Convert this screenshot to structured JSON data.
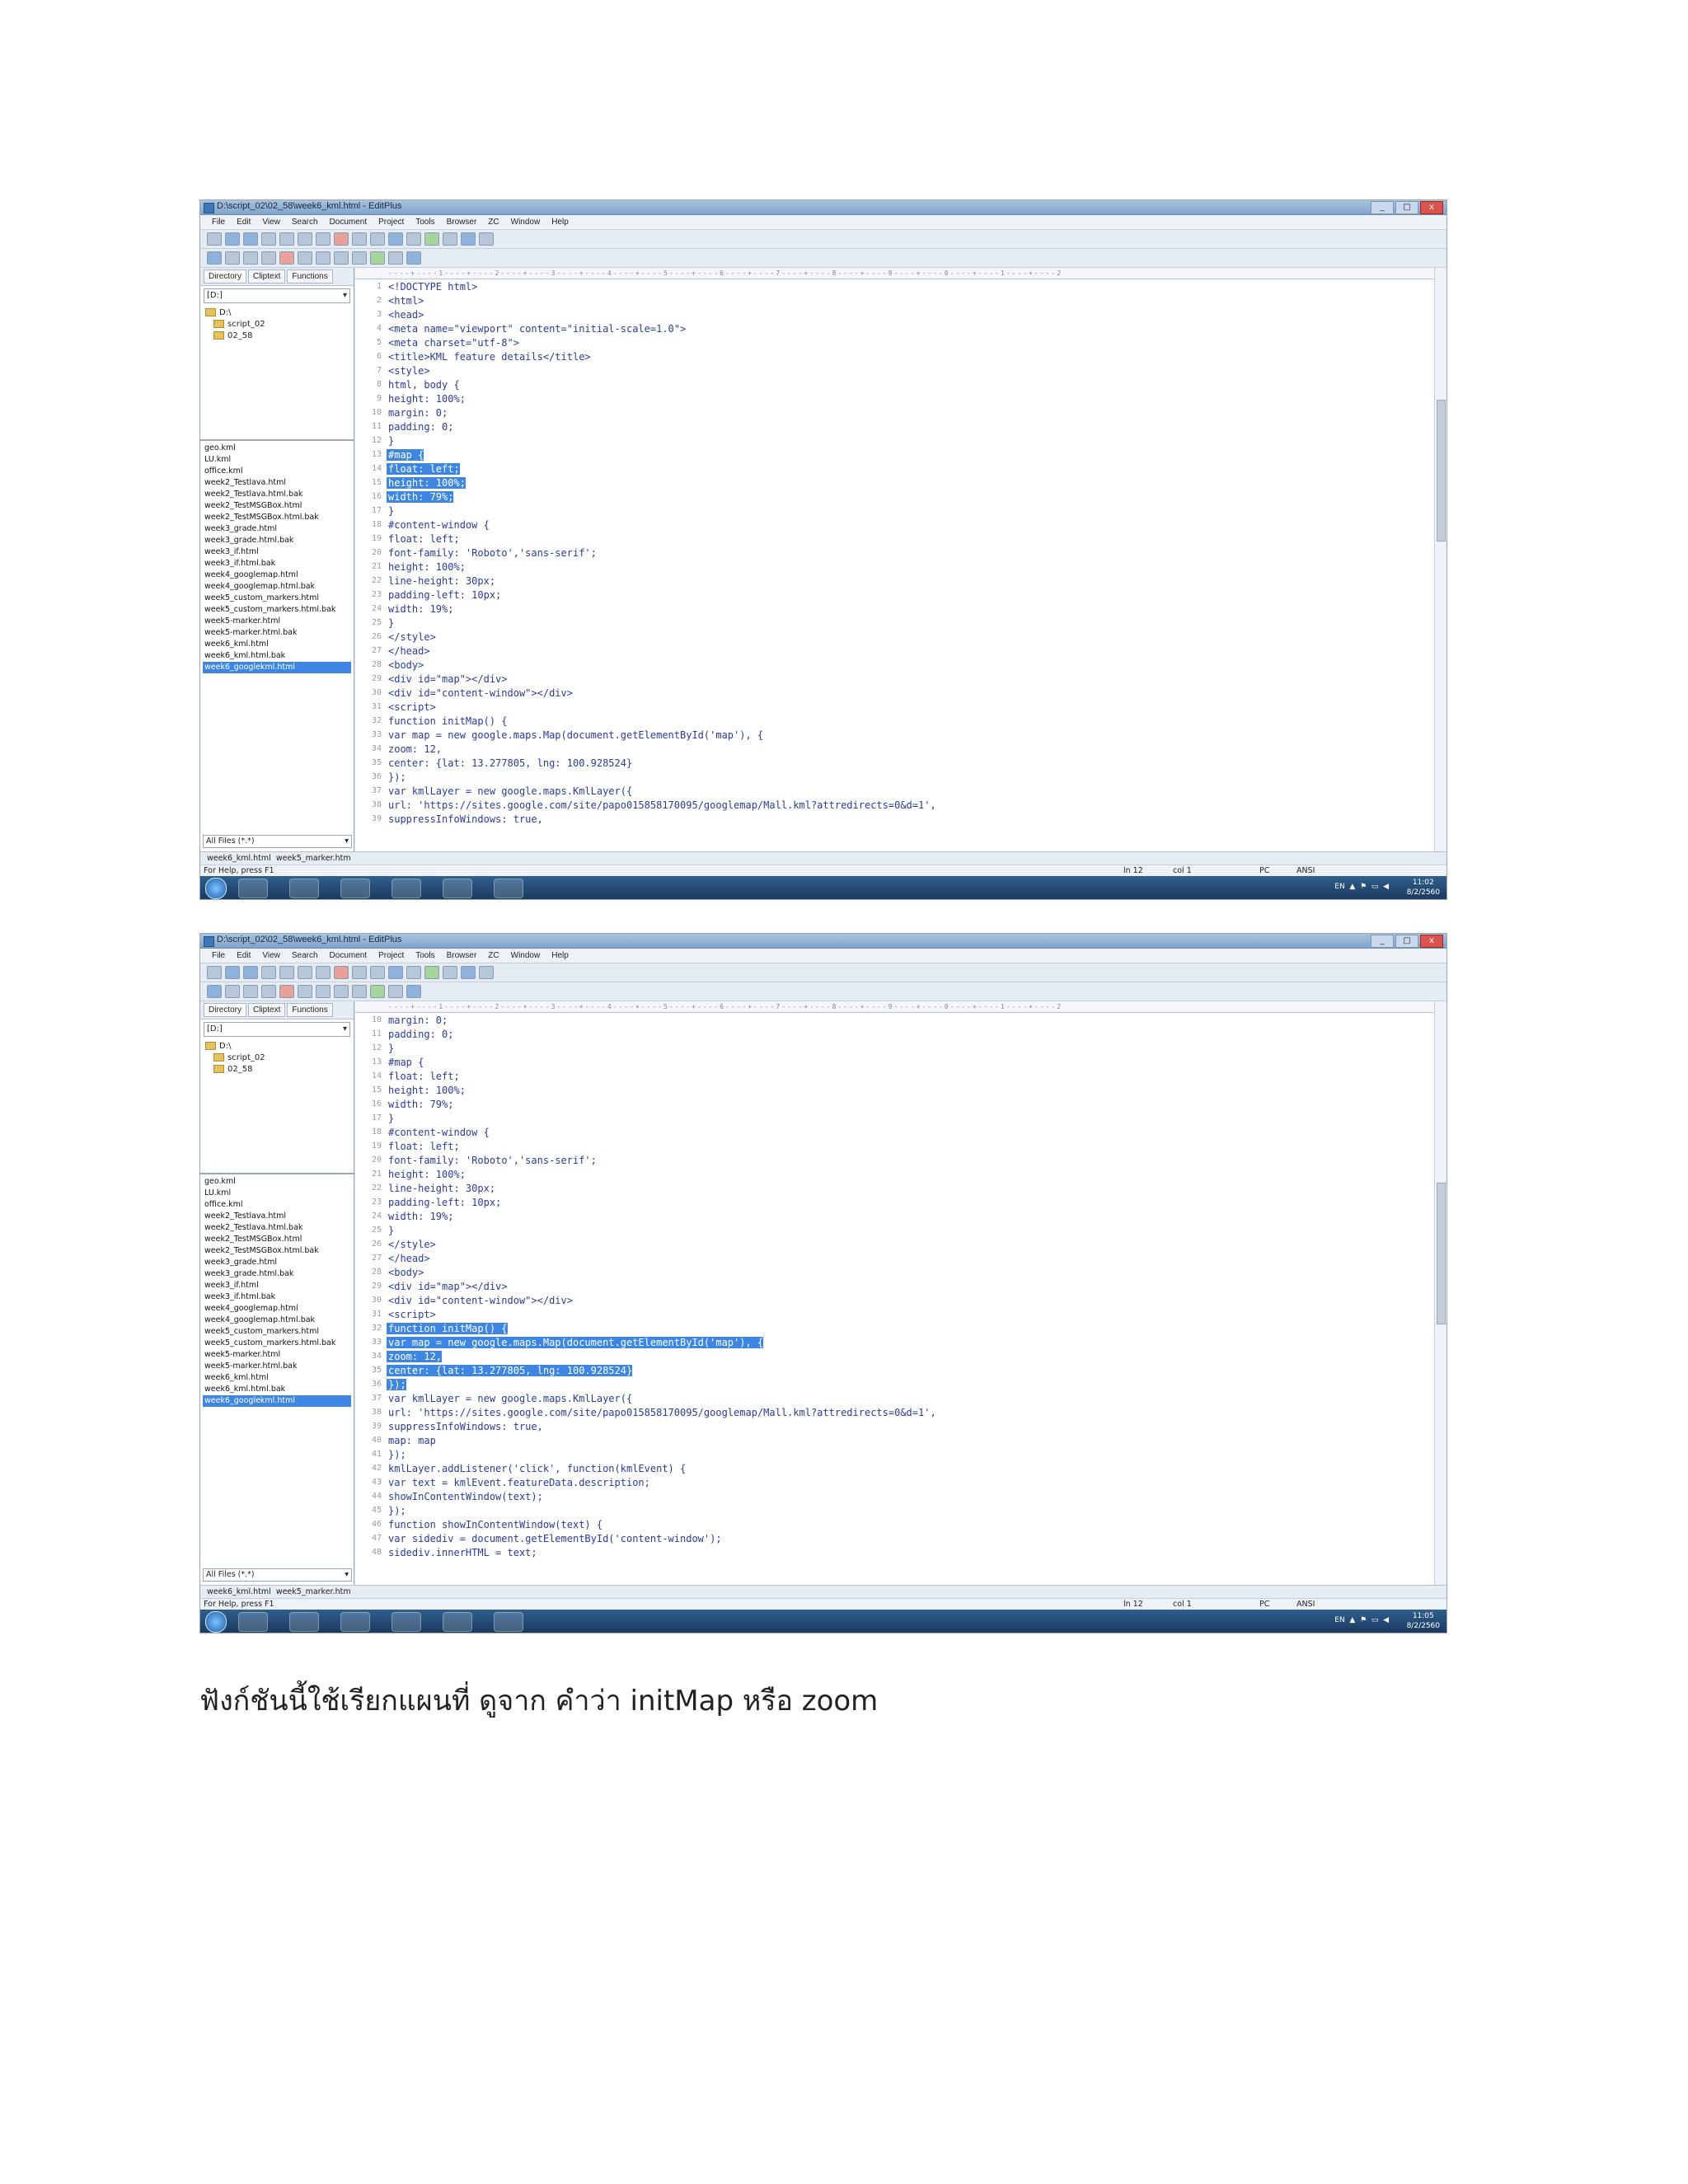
{
  "window": {
    "title": "D:\\script_02\\02_58\\week6_kml.html - EditPlus",
    "buttons": [
      "_",
      "□",
      "x"
    ]
  },
  "menu": [
    "File",
    "Edit",
    "View",
    "Search",
    "Document",
    "Project",
    "Tools",
    "Browser",
    "ZC",
    "Window",
    "Help"
  ],
  "left_pane": {
    "tabs": [
      "Directory",
      "Cliptext",
      "Functions"
    ],
    "drive": "[D:]",
    "tree": [
      "D:\\",
      "script_02",
      "02_58"
    ],
    "files": [
      "geo.kml",
      "LU.kml",
      "office.kml",
      "week2_Testlava.html",
      "week2_Testlava.html.bak",
      "week2_TestMSGBox.html",
      "week2_TestMSGBox.html.bak",
      "week3_grade.html",
      "week3_grade.html.bak",
      "week3_if.html",
      "week3_if.html.bak",
      "week4_googlemap.html",
      "week4_googlemap.html.bak",
      "week5_custom_markers.html",
      "week5_custom_markers.html.bak",
      "week5-marker.html",
      "week5-marker.html.bak",
      "week6_kml.html",
      "week6_kml.html.bak",
      "week6_googlekml.html"
    ],
    "filter": "All Files (*.*)"
  },
  "doc_tabs": [
    "week6_kml.html",
    "week5_marker.htm"
  ],
  "status": {
    "help": "For Help, press F1",
    "ln": "ln 12",
    "col": "col 1",
    "enc": "ANSI",
    "mode": "PC"
  },
  "taskbar": {
    "tray": "EN  ▲  ⚑  ▭  ◀",
    "time1": "11:02",
    "time2": "11:05",
    "date": "8/2/2560"
  },
  "editor1": {
    "lines": [
      {
        "n": "1",
        "t": "<!DOCTYPE html>",
        "hl": false
      },
      {
        "n": "2",
        "t": "<html>",
        "hl": false
      },
      {
        "n": "3",
        "t": "<head>",
        "hl": false
      },
      {
        "n": "4",
        "t": "<meta name=\"viewport\" content=\"initial-scale=1.0\">",
        "hl": false
      },
      {
        "n": "5",
        "t": "<meta charset=\"utf-8\">",
        "hl": false
      },
      {
        "n": "6",
        "t": "<title>KML feature details</title>",
        "hl": false
      },
      {
        "n": "7",
        "t": "<style>",
        "hl": false
      },
      {
        "n": "8",
        "t": "html, body {",
        "hl": false
      },
      {
        "n": "9",
        "t": "height: 100%;",
        "hl": false
      },
      {
        "n": "10",
        "t": "margin: 0;",
        "hl": false
      },
      {
        "n": "11",
        "t": "padding: 0;",
        "hl": false
      },
      {
        "n": "12",
        "t": "}",
        "hl": false
      },
      {
        "n": "13",
        "t": "#map {",
        "hl": true
      },
      {
        "n": "14",
        "t": "float: left;",
        "hl": true
      },
      {
        "n": "15",
        "t": "height: 100%;",
        "hl": true
      },
      {
        "n": "16",
        "t": "width: 79%;",
        "hl": true
      },
      {
        "n": "17",
        "t": "}",
        "hl": false
      },
      {
        "n": "18",
        "t": "#content-window {",
        "hl": false
      },
      {
        "n": "19",
        "t": "float: left;",
        "hl": false
      },
      {
        "n": "20",
        "t": "font-family: 'Roboto','sans-serif';",
        "hl": false
      },
      {
        "n": "21",
        "t": "height: 100%;",
        "hl": false
      },
      {
        "n": "22",
        "t": "line-height: 30px;",
        "hl": false
      },
      {
        "n": "23",
        "t": "padding-left: 10px;",
        "hl": false
      },
      {
        "n": "24",
        "t": "width: 19%;",
        "hl": false
      },
      {
        "n": "25",
        "t": "}",
        "hl": false
      },
      {
        "n": "26",
        "t": "</style>",
        "hl": false
      },
      {
        "n": "27",
        "t": "</head>",
        "hl": false
      },
      {
        "n": "28",
        "t": "<body>",
        "hl": false
      },
      {
        "n": "29",
        "t": "<div id=\"map\"></div>",
        "hl": false
      },
      {
        "n": "30",
        "t": "<div id=\"content-window\"></div>",
        "hl": false
      },
      {
        "n": "31",
        "t": "<script>",
        "hl": false
      },
      {
        "n": "32",
        "t": "function initMap() {",
        "hl": false
      },
      {
        "n": "33",
        "t": "var map = new google.maps.Map(document.getElementById('map'), {",
        "hl": false
      },
      {
        "n": "34",
        "t": "zoom: 12,",
        "hl": false
      },
      {
        "n": "35",
        "t": "center: {lat: 13.277805, lng: 100.928524}",
        "hl": false
      },
      {
        "n": "36",
        "t": "});",
        "hl": false
      },
      {
        "n": "37",
        "t": "var kmlLayer = new google.maps.KmlLayer({",
        "hl": false
      },
      {
        "n": "38",
        "t": "url: 'https://sites.google.com/site/papo015858170095/googlemap/Mall.kml?attredirects=0&d=1',",
        "hl": false
      },
      {
        "n": "39",
        "t": "suppressInfoWindows: true,",
        "hl": false
      }
    ]
  },
  "editor2": {
    "lines": [
      {
        "n": "10",
        "t": "margin: 0;",
        "hl": false
      },
      {
        "n": "11",
        "t": "padding: 0;",
        "hl": false
      },
      {
        "n": "12",
        "t": "}",
        "hl": false
      },
      {
        "n": "13",
        "t": "#map {",
        "hl": false
      },
      {
        "n": "14",
        "t": "float: left;",
        "hl": false
      },
      {
        "n": "15",
        "t": "height: 100%;",
        "hl": false
      },
      {
        "n": "16",
        "t": "width: 79%;",
        "hl": false
      },
      {
        "n": "17",
        "t": "}",
        "hl": false
      },
      {
        "n": "18",
        "t": "#content-window {",
        "hl": false
      },
      {
        "n": "19",
        "t": "float: left;",
        "hl": false
      },
      {
        "n": "20",
        "t": "font-family: 'Roboto','sans-serif';",
        "hl": false
      },
      {
        "n": "21",
        "t": "height: 100%;",
        "hl": false
      },
      {
        "n": "22",
        "t": "line-height: 30px;",
        "hl": false
      },
      {
        "n": "23",
        "t": "padding-left: 10px;",
        "hl": false
      },
      {
        "n": "24",
        "t": "width: 19%;",
        "hl": false
      },
      {
        "n": "25",
        "t": "}",
        "hl": false
      },
      {
        "n": "26",
        "t": "</style>",
        "hl": false
      },
      {
        "n": "27",
        "t": "</head>",
        "hl": false
      },
      {
        "n": "28",
        "t": "<body>",
        "hl": false
      },
      {
        "n": "29",
        "t": "<div id=\"map\"></div>",
        "hl": false
      },
      {
        "n": "30",
        "t": "<div id=\"content-window\"></div>",
        "hl": false
      },
      {
        "n": "31",
        "t": "<script>",
        "hl": false
      },
      {
        "n": "32",
        "t": "function initMap() {",
        "hl": true
      },
      {
        "n": "33",
        "t": "var map = new google.maps.Map(document.getElementById('map'), {",
        "hl": true
      },
      {
        "n": "34",
        "t": "zoom: 12,",
        "hl": true
      },
      {
        "n": "35",
        "t": "center: {lat: 13.277805, lng: 100.928524}",
        "hl": true
      },
      {
        "n": "36",
        "t": "});",
        "hl": true
      },
      {
        "n": "37",
        "t": "var kmlLayer = new google.maps.KmlLayer({",
        "hl": false
      },
      {
        "n": "38",
        "t": "url: 'https://sites.google.com/site/papo015858170095/googlemap/Mall.kml?attredirects=0&d=1',",
        "hl": false
      },
      {
        "n": "39",
        "t": "suppressInfoWindows: true,",
        "hl": false
      },
      {
        "n": "40",
        "t": "map: map",
        "hl": false
      },
      {
        "n": "41",
        "t": "});",
        "hl": false
      },
      {
        "n": "42",
        "t": "kmlLayer.addListener('click', function(kmlEvent) {",
        "hl": false
      },
      {
        "n": "43",
        "t": "var text = kmlEvent.featureData.description;",
        "hl": false
      },
      {
        "n": "44",
        "t": "showInContentWindow(text);",
        "hl": false
      },
      {
        "n": "45",
        "t": "});",
        "hl": false
      },
      {
        "n": "46",
        "t": "function showInContentWindow(text) {",
        "hl": false
      },
      {
        "n": "47",
        "t": "var sidediv = document.getElementById('content-window');",
        "hl": false
      },
      {
        "n": "48",
        "t": "sidediv.innerHTML = text;",
        "hl": false
      }
    ]
  },
  "caption": "ฟังก์ชันนี้ใช้เรียกแผนที่ ดูจาก คำว่า initMap หรือ zoom"
}
